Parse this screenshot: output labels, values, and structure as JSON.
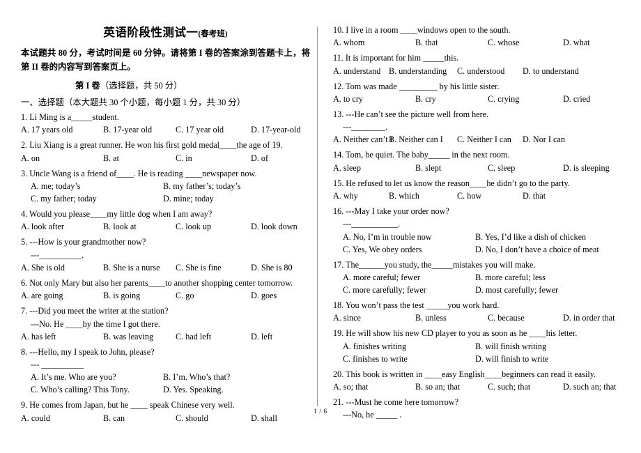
{
  "header": {
    "title_main": "英语阶段性测试一",
    "title_sub": "(春考班)",
    "instructions": "本试题共 80 分，考试时间是 60 分钟。请将第 I 卷的答案涂到答题卡上，将第 II 卷的内容写到答案页上。",
    "part_heading_bold": "第 I 卷",
    "part_heading_thin": "（选择题，共 50 分）",
    "section_heading": "一、选择题（本大题共 30 个小题，每小题 1 分，共 30 分）"
  },
  "footer": {
    "page_label": "1 / 6"
  },
  "left_column": [
    {
      "number": "1.",
      "stem": "Li Ming is a_____student.",
      "options": [
        "A. 17 years old",
        "B. 17-year old",
        "C. 17 year old",
        "D. 17-year-old"
      ],
      "layout": "four"
    },
    {
      "number": "2.",
      "stem": "Liu Xiang is a great runner. He won his first gold medal____the age of 19.",
      "options": [
        "A. on",
        "B. at",
        "C. in",
        "D. of"
      ],
      "layout": "four"
    },
    {
      "number": "3.",
      "stem": "Uncle Wang is a friend of____. He is reading ____newspaper now.",
      "options": [
        "A. me; today’s",
        "B. my father’s; today’s",
        "C. my father; today",
        "D. mine; today"
      ],
      "layout": "two-by-two"
    },
    {
      "number": "4.",
      "stem": "Would you please____my little dog when I am away?",
      "options": [
        "A. look after",
        "B. look at",
        "C. look up",
        "D. look down"
      ],
      "layout": "four"
    },
    {
      "number": "5.",
      "stem": "---How is your grandmother now?",
      "stem2": "---__________.",
      "options": [
        "A. She is old",
        "B. She is a nurse",
        "C. She is fine",
        "D. She is 80"
      ],
      "layout": "four"
    },
    {
      "number": "6.",
      "stem": "Not only Mary but also her parents____to another shopping center tomorrow.",
      "options": [
        "A. are going",
        "B. is going",
        "C. go",
        "D. goes"
      ],
      "layout": "four"
    },
    {
      "number": "7.",
      "stem": "---Did you meet the writer at the station?",
      "stem2": "---No. He ____by the time I got there.",
      "options": [
        "A. has left",
        "B. was leaving",
        "C. had left",
        "D. left"
      ],
      "layout": "four"
    },
    {
      "number": "8.",
      "stem": "---Hello, my I speak to John, please?",
      "stem2": "--- __________",
      "options": [
        "A. It’s me. Who are you?",
        "B. I’m. Who’s that?",
        "C. Who’s calling? This Tony.",
        "D. Yes. Speaking."
      ],
      "layout": "two-by-two"
    },
    {
      "number": "9.",
      "stem": "He comes from Japan, but he ____ speak Chinese very well.",
      "options": [
        "A. could",
        "B. can",
        "C. should",
        "D. shall"
      ],
      "layout": "four"
    }
  ],
  "right_column": [
    {
      "number": "10.",
      "stem": "I live in a room ____windows open to the south.",
      "options": [
        "A. whom",
        "B. that",
        "C. whose",
        "D. what"
      ],
      "layout": "four"
    },
    {
      "number": "11.",
      "stem": "It is important for him _____this.",
      "options": [
        "A. understand",
        "B. understanding",
        "C. understood",
        "D. to understand"
      ],
      "layout": "four-tight"
    },
    {
      "number": "12.",
      "stem": "Tom was made _________ by his little sister.",
      "options": [
        "A. to cry",
        "B. cry",
        "C. crying",
        "D. cried"
      ],
      "layout": "four"
    },
    {
      "number": "13.",
      "stem": "---He can’t see the picture well from here.",
      "stem2": "---________.",
      "options": [
        "A. Neither can’t I",
        "B. Neither can I",
        "C. Neither I can",
        "D. Nor I can"
      ],
      "layout": "four-tight"
    },
    {
      "number": "14.",
      "stem": "Tom, be quiet. The baby_____ in the next room.",
      "options": [
        "A. sleep",
        "B. slept",
        "C. sleep",
        "D. is sleeping"
      ],
      "layout": "four"
    },
    {
      "number": "15.",
      "stem": "He refused to let us know the reason____he didn’t go to the party.",
      "options": [
        "A. why",
        "B. which",
        "C. how",
        "D. that"
      ],
      "layout": "four-tight"
    },
    {
      "number": "16.",
      "stem": "---May I take your order now?",
      "stem2": "---___________.",
      "options": [
        "A. No, I’m in trouble now",
        "B. Yes, I’d like a dish of chicken",
        "C. Yes, We obey orders",
        "D. No, I don’t have a choice of meat"
      ],
      "layout": "two-by-two"
    },
    {
      "number": "17.",
      "stem": "The______you study, the_____mistakes you will make.",
      "options": [
        "A. more careful; fewer",
        "B. more careful; less",
        "C. more carefully; fewer",
        "D. most carefully; fewer"
      ],
      "layout": "two-by-two"
    },
    {
      "number": "18.",
      "stem": "You won’t pass the test _____you work hard.",
      "options": [
        "A. since",
        "B. unless",
        "C. because",
        "D. in order that"
      ],
      "layout": "four"
    },
    {
      "number": "19.",
      "stem": "He will show his new CD player to you as soon as he ____his letter.",
      "options": [
        "A. finishes writing",
        "B. will finish writing",
        "C. finishes to write",
        "D. will finish to write"
      ],
      "layout": "two-by-two"
    },
    {
      "number": "20.",
      "stem": "This book is written in ____easy English____beginners can read it easily.",
      "options": [
        "A. so; that",
        "B. so an; that",
        "C. such; that",
        "D. such an; that"
      ],
      "layout": "four"
    },
    {
      "number": "21.",
      "stem": "---Must he come here tomorrow?",
      "stem2": "---No, he _____ .",
      "options": [],
      "layout": "none"
    }
  ]
}
